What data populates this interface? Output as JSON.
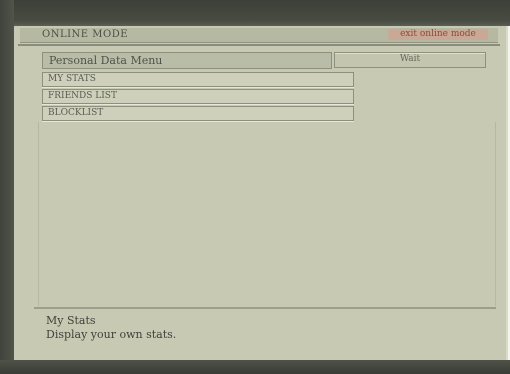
{
  "header": {
    "title": "ONLINE MODE",
    "action_label": "exit online mode"
  },
  "menu": {
    "title": "Personal Data Menu",
    "status": "Wait",
    "items": [
      {
        "label": "MY STATS"
      },
      {
        "label": "FRIENDS LIST"
      },
      {
        "label": "BLOCKLIST"
      }
    ]
  },
  "help": {
    "title": "My Stats",
    "description": "Display your own stats."
  }
}
